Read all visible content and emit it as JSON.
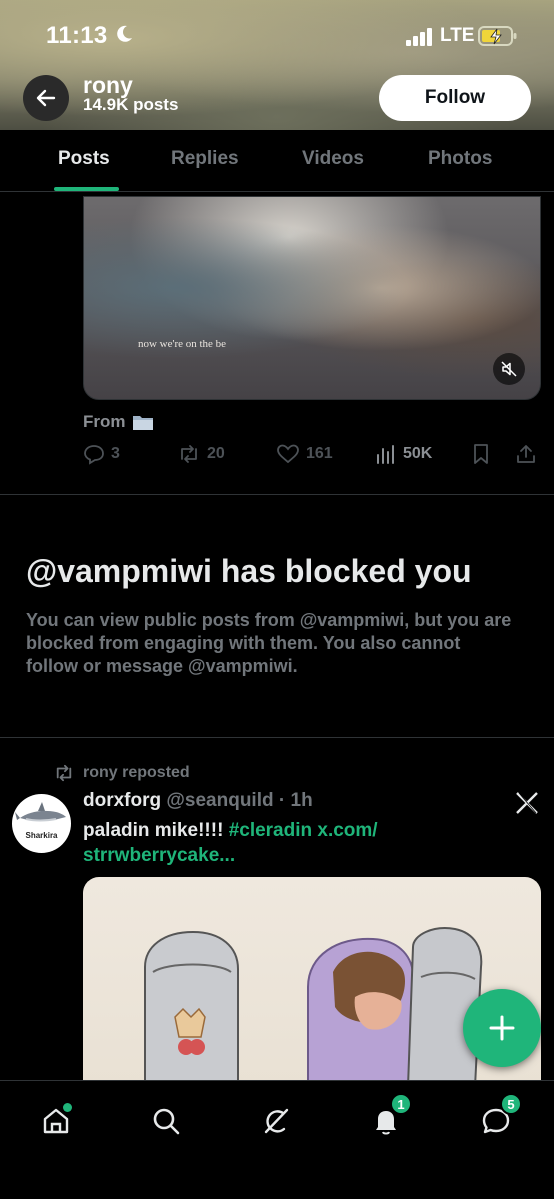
{
  "status_bar": {
    "time": "11:13",
    "network": "LTE"
  },
  "header": {
    "name": "rony",
    "post_count": "14.9K posts",
    "follow_label": "Follow"
  },
  "tabs": [
    {
      "label": "Posts",
      "active": true
    },
    {
      "label": "Replies",
      "active": false
    },
    {
      "label": "Videos",
      "active": false
    },
    {
      "label": "Photos",
      "active": false
    }
  ],
  "post1": {
    "video_caption": "now we're on the be",
    "from_label": "From",
    "from_icon": "folder-icon",
    "replies": "3",
    "reposts": "20",
    "likes": "161",
    "views": "50K"
  },
  "blocked": {
    "title": "@vampmiwi has blocked you",
    "text": "You can view public posts from @vampmiwi, but you are blocked from engaging with them. You also cannot follow or message @vampmiwi."
  },
  "post2": {
    "repost_label": "rony reposted",
    "avatar_label": "Sharkira",
    "author_name": "dorxforg",
    "author_handle": "@seanquild",
    "time": "· 1h",
    "text_plain": "paladin mike!!!! ",
    "text_link": "#cleradin x.com/ strrwberrycake..."
  },
  "nav": {
    "notifications_badge": "1",
    "messages_badge": "5"
  },
  "colors": {
    "accent": "#1fb57a",
    "background": "#000000",
    "muted": "#71767b"
  }
}
